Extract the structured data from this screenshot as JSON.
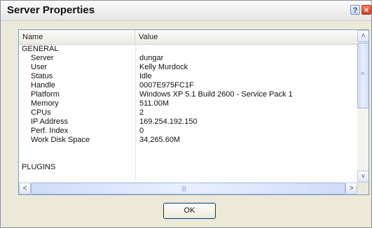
{
  "window": {
    "title": "Server Properties",
    "help_label": "?",
    "close_label": "×"
  },
  "list": {
    "columns": [
      "Name",
      "Value"
    ],
    "groups": [
      {
        "label": "GENERAL",
        "rows": [
          {
            "name": "Server",
            "value": "dungar"
          },
          {
            "name": "User",
            "value": "Kelly Murdock"
          },
          {
            "name": "Status",
            "value": "Idle"
          },
          {
            "name": "Handle",
            "value": "0007E975FC1F"
          },
          {
            "name": "Platform",
            "value": "Windows XP 5.1 Build 2600 - Service Pack 1"
          },
          {
            "name": "Memory",
            "value": "511.00M"
          },
          {
            "name": "CPUs",
            "value": "2"
          },
          {
            "name": "IP Address",
            "value": "169.254.192.150"
          },
          {
            "name": "Perf. Index",
            "value": "0"
          },
          {
            "name": "Work Disk Space",
            "value": "34,265.60M"
          }
        ]
      },
      {
        "label": "PLUGINS",
        "rows": []
      }
    ]
  },
  "scrollbars": {
    "up_glyph": "˄",
    "down_glyph": "˅",
    "left_glyph": "<",
    "right_glyph": ">",
    "vertical_grip": "≡",
    "horizontal_grip": "|||"
  },
  "buttons": {
    "ok_label": "OK"
  }
}
